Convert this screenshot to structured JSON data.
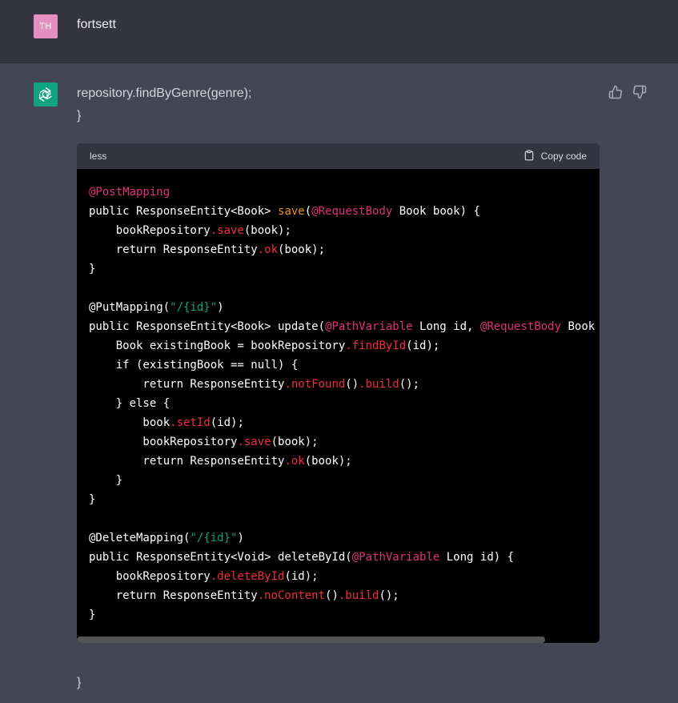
{
  "user": {
    "avatar_initials": "TH",
    "message": "fortsett"
  },
  "assistant": {
    "text_line1": "repository.findByGenre(genre);",
    "text_line2": "}",
    "text_end": "}"
  },
  "code_block": {
    "language": "less",
    "copy_label": "Copy code",
    "colors": {
      "default": "#ffffff",
      "annotation": "#df3079",
      "method": "#f22c3d",
      "string": "#00a67d",
      "function_highlight": "#e9950c"
    },
    "lines": [
      [
        {
          "t": "@PostMapping",
          "c": "annotation"
        }
      ],
      [
        {
          "t": "public ResponseEntity<Book> ",
          "c": "default"
        },
        {
          "t": "save",
          "c": "function_highlight"
        },
        {
          "t": "(",
          "c": "default"
        },
        {
          "t": "@RequestBody",
          "c": "annotation"
        },
        {
          "t": " Book book) {",
          "c": "default"
        }
      ],
      [
        {
          "t": "    bookRepository",
          "c": "default"
        },
        {
          "t": ".save",
          "c": "method"
        },
        {
          "t": "(book);",
          "c": "default"
        }
      ],
      [
        {
          "t": "    return ResponseEntity",
          "c": "default"
        },
        {
          "t": ".ok",
          "c": "method"
        },
        {
          "t": "(book);",
          "c": "default"
        }
      ],
      [
        {
          "t": "}",
          "c": "default"
        }
      ],
      [
        {
          "t": "",
          "c": "default"
        }
      ],
      [
        {
          "t": "@PutMapping(",
          "c": "default"
        },
        {
          "t": "\"/{id}\"",
          "c": "string"
        },
        {
          "t": ")",
          "c": "default"
        }
      ],
      [
        {
          "t": "public ResponseEntity<Book> update(",
          "c": "default"
        },
        {
          "t": "@PathVariable",
          "c": "annotation"
        },
        {
          "t": " Long id, ",
          "c": "default"
        },
        {
          "t": "@RequestBody",
          "c": "annotation"
        },
        {
          "t": " Book",
          "c": "default"
        }
      ],
      [
        {
          "t": "    Book existingBook = bookRepository",
          "c": "default"
        },
        {
          "t": ".findById",
          "c": "method"
        },
        {
          "t": "(id);",
          "c": "default"
        }
      ],
      [
        {
          "t": "    if (existingBook == null) {",
          "c": "default"
        }
      ],
      [
        {
          "t": "        return ResponseEntity",
          "c": "default"
        },
        {
          "t": ".notFound",
          "c": "method"
        },
        {
          "t": "()",
          "c": "default"
        },
        {
          "t": ".build",
          "c": "method"
        },
        {
          "t": "();",
          "c": "default"
        }
      ],
      [
        {
          "t": "    } else {",
          "c": "default"
        }
      ],
      [
        {
          "t": "        book",
          "c": "default"
        },
        {
          "t": ".setId",
          "c": "method"
        },
        {
          "t": "(id);",
          "c": "default"
        }
      ],
      [
        {
          "t": "        bookRepository",
          "c": "default"
        },
        {
          "t": ".save",
          "c": "method"
        },
        {
          "t": "(book);",
          "c": "default"
        }
      ],
      [
        {
          "t": "        return ResponseEntity",
          "c": "default"
        },
        {
          "t": ".ok",
          "c": "method"
        },
        {
          "t": "(book);",
          "c": "default"
        }
      ],
      [
        {
          "t": "    }",
          "c": "default"
        }
      ],
      [
        {
          "t": "}",
          "c": "default"
        }
      ],
      [
        {
          "t": "",
          "c": "default"
        }
      ],
      [
        {
          "t": "@DeleteMapping(",
          "c": "default"
        },
        {
          "t": "\"/{id}\"",
          "c": "string"
        },
        {
          "t": ")",
          "c": "default"
        }
      ],
      [
        {
          "t": "public ResponseEntity<Void> deleteById(",
          "c": "default"
        },
        {
          "t": "@PathVariable",
          "c": "annotation"
        },
        {
          "t": " Long id) {",
          "c": "default"
        }
      ],
      [
        {
          "t": "    bookRepository",
          "c": "default"
        },
        {
          "t": ".deleteById",
          "c": "method"
        },
        {
          "t": "(id);",
          "c": "default"
        }
      ],
      [
        {
          "t": "    return ResponseEntity",
          "c": "default"
        },
        {
          "t": ".noContent",
          "c": "method"
        },
        {
          "t": "()",
          "c": "default"
        },
        {
          "t": ".build",
          "c": "method"
        },
        {
          "t": "();",
          "c": "default"
        }
      ],
      [
        {
          "t": "}",
          "c": "default"
        }
      ]
    ]
  }
}
